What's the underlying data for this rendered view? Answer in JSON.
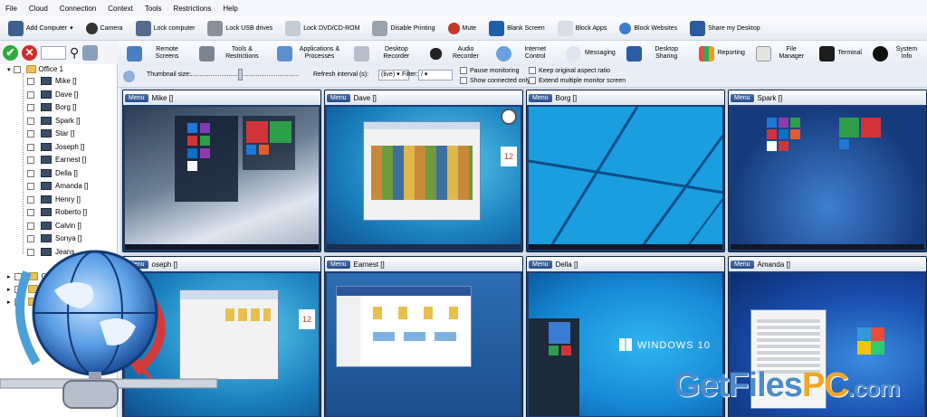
{
  "menu": [
    "File",
    "Cloud",
    "Connection",
    "Context",
    "Tools",
    "Restrictions",
    "Help"
  ],
  "toolbar1": [
    "Add Computer",
    "Camera",
    "Lock computer",
    "Lock USB drives",
    "Lock DVD/CD-ROM",
    "Disable Printing",
    "Mute",
    "Blank Screen",
    "Block Apps",
    "Block Websites",
    "Share my Desktop"
  ],
  "toolbar2": [
    "Remote Screens",
    "Tools & Restrictions",
    "Applications & Processes",
    "Desktop Recorder",
    "Audio Recorder",
    "Internet Control",
    "Messaging",
    "Desktop Sharing",
    "Reporting",
    "File Manager",
    "Terminal",
    "System Info"
  ],
  "options": {
    "thumbnail_size": "Thumbnail size:",
    "refresh_interval": "Refresh interval (s):",
    "refresh_value": "(live)",
    "filter": "Filter:",
    "filter_value": "/",
    "pause_monitoring": "Pause monitoring",
    "show_connected_only": "Show connected only",
    "keep_aspect_ratio": "Keep original aspect ratio",
    "extend_monitor": "Extend multiple monitor screen"
  },
  "tree": {
    "group": "Office 1",
    "computers": [
      "Mike []",
      "Dave []",
      "Borg []",
      "Spark []",
      "Star []",
      "Joseph []",
      "Earnest []",
      "Della []",
      "Amanda []",
      "Henry []",
      "Roberto []",
      "Calvin []",
      "Sonya []",
      "Jeans"
    ],
    "partial_groups": [
      "Off",
      "O",
      "M"
    ]
  },
  "tiles": [
    {
      "menu": "Menu",
      "name": "Mike []"
    },
    {
      "menu": "Menu",
      "name": "Dave []"
    },
    {
      "menu": "Menu",
      "name": "Borg []"
    },
    {
      "menu": "Menu",
      "name": "Spark []"
    },
    {
      "menu": "Menu",
      "name": "oseph []"
    },
    {
      "menu": "Menu",
      "name": "Earnest []"
    },
    {
      "menu": "Menu",
      "name": "Della []"
    },
    {
      "menu": "Menu",
      "name": "Amanda []"
    }
  ],
  "screen_text": {
    "windows10": "WINDOWS 10",
    "clock_day": "12"
  },
  "watermark": {
    "part1": "GetFiles",
    "part2": "PC",
    "part3": ".com"
  },
  "colors": {
    "accent": "#1f3d73",
    "ok": "#2eaa3a",
    "cancel": "#d12a2a",
    "win10blue": "#1789d6"
  }
}
